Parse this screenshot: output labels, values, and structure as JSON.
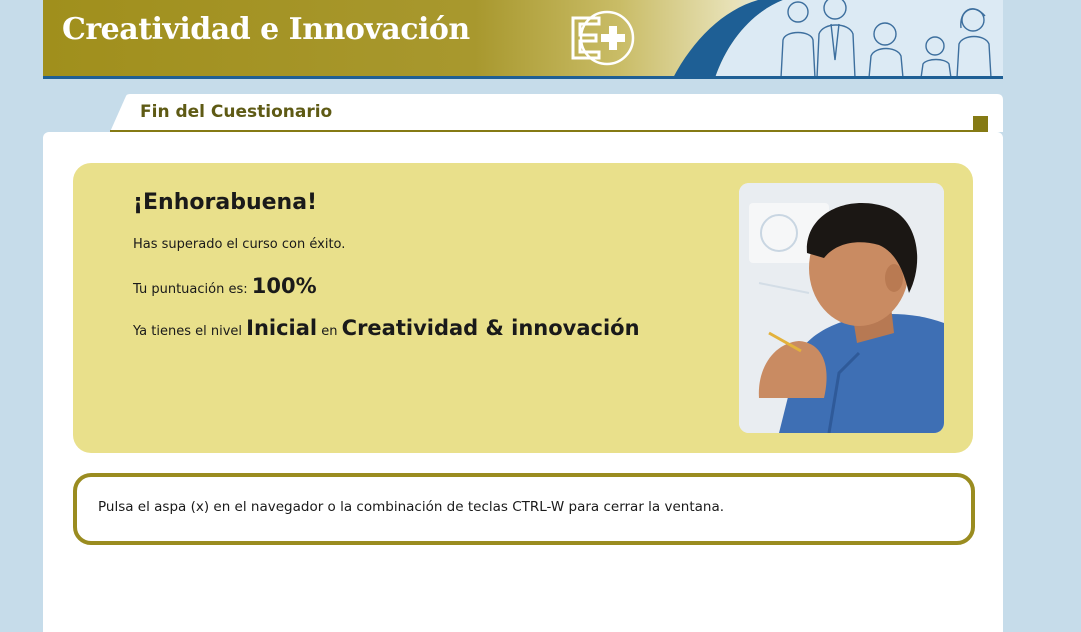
{
  "header": {
    "title": "Creatividad e Innovación",
    "logo_icon": "e-plus-logo-icon",
    "illustration_icon": "people-illustration-icon",
    "colors": {
      "gold": "#a08f1c",
      "blue": "#1e5f95"
    }
  },
  "tab": {
    "label": "Fin del Cuestionario"
  },
  "result": {
    "heading": "¡Enhorabuena!",
    "passed_text": "Has superado el curso con éxito.",
    "score_label": "Tu puntuación es:",
    "score_value": "100%",
    "level_prefix": "Ya tienes el nivel",
    "level_value": "Inicial",
    "level_joiner": "en",
    "course_name": "Creatividad & innovación",
    "photo_icon": "thinking-man-photo-icon",
    "box_color": "#e9e08b"
  },
  "notice": {
    "text": "Pulsa el aspa (x) en el navegador o la combinación de teclas CTRL-W para cerrar la ventana."
  }
}
